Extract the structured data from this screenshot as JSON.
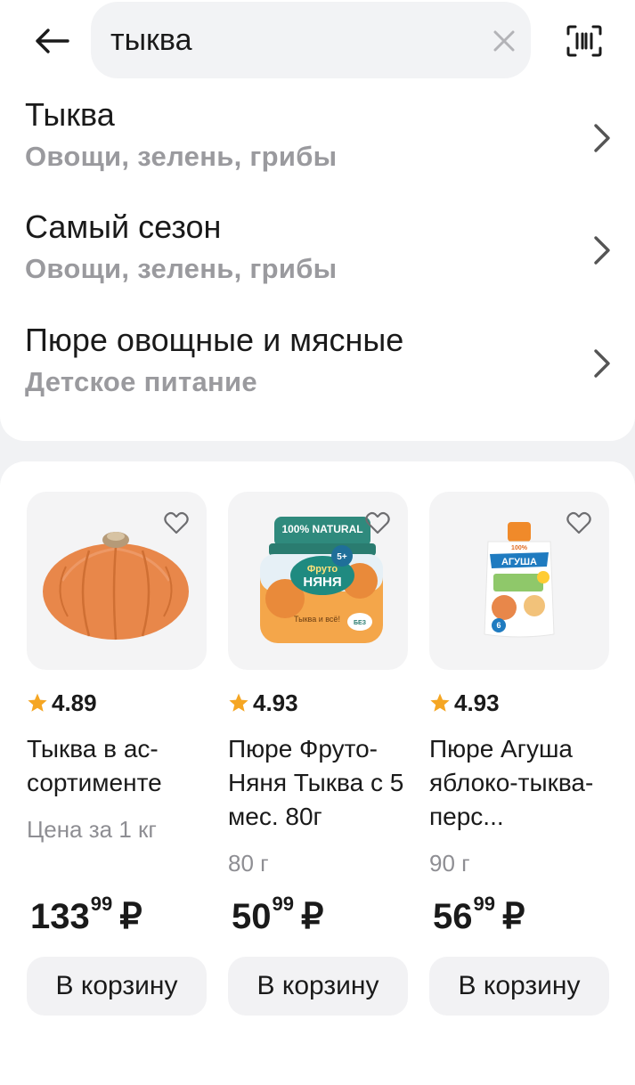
{
  "search": {
    "value": "тыква",
    "placeholder": ""
  },
  "suggestions": [
    {
      "title": "Тыква",
      "subtitle": "Овощи, зелень, грибы"
    },
    {
      "title": "Самый сезон",
      "subtitle": "Овощи, зелень, грибы"
    },
    {
      "title": "Пюре овощные и мясные",
      "subtitle": "Детское питание"
    }
  ],
  "products": [
    {
      "rating": "4.89",
      "name": "Тыква в ас-сортименте",
      "note": "Цена за 1 кг",
      "price_main": "133",
      "price_cents": "99",
      "currency": "₽",
      "cart_label": "В корзину"
    },
    {
      "rating": "4.93",
      "name": "Пюре Фруто-Няня Тыква с 5 мес. 80г",
      "note": "80 г",
      "price_main": "50",
      "price_cents": "99",
      "currency": "₽",
      "cart_label": "В корзину",
      "package": {
        "banner": "100% NATURAL",
        "brand_top": "Фруто",
        "brand_bottom": "НЯНЯ",
        "age": "5+",
        "flavor": "Тыква и всё!",
        "badge": "БЕЗ"
      }
    },
    {
      "rating": "4.93",
      "name": "Пюре Агуша яблоко-тыква-перс...",
      "note": "90 г",
      "price_main": "56",
      "price_cents": "99",
      "currency": "₽",
      "cart_label": "В корзину",
      "package": {
        "brand": "АГУША",
        "top": "100%",
        "age": "6"
      }
    }
  ],
  "colors": {
    "star": "#f5a623",
    "pumpkin": "#e8874a",
    "caret": "#2b6fe0"
  },
  "icons": {
    "back": "arrow-left-icon",
    "clear": "close-icon",
    "scan": "barcode-scan-icon",
    "chevron": "chevron-right-icon",
    "heart": "heart-icon",
    "star": "star-icon"
  }
}
